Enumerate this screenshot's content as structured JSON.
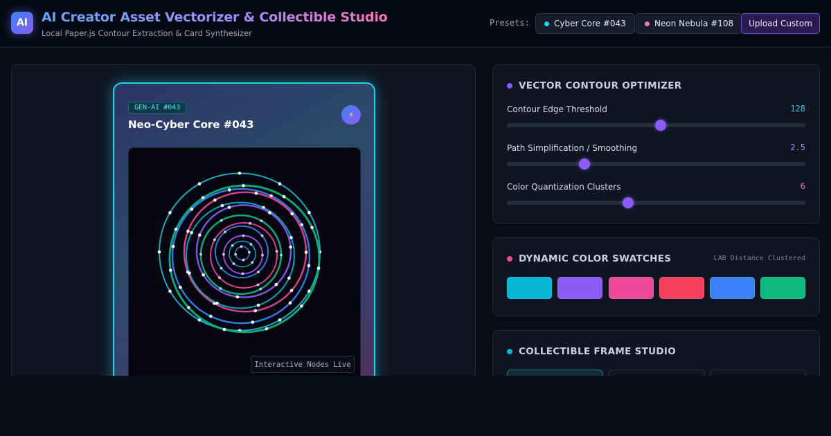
{
  "header": {
    "logo_text": "AI",
    "title": "AI Creator Asset Vectorizer & Collectible Studio",
    "subtitle": "Local Paper.js Contour Extraction & Card Synthesizer",
    "presets_label": "Presets:",
    "presets": [
      {
        "label": "Cyber Core #043",
        "color": "#22d3ee"
      },
      {
        "label": "Neon Nebula #108",
        "color": "#f472b6"
      }
    ],
    "upload_label": "Upload Custom"
  },
  "card": {
    "badge": "GEN-AI #043",
    "title": "Neo-Cyber Core #043",
    "bolt_icon": "lightning-icon",
    "live_tag": "Interactive Nodes Live"
  },
  "optimizer": {
    "title": "VECTOR CONTOUR OPTIMIZER",
    "dot_color": "#8b5cf6",
    "sliders": [
      {
        "label": "Contour Edge Threshold",
        "value": "128",
        "fraction": 0.515,
        "value_color": "#22d3ee"
      },
      {
        "label": "Path Simplification / Smoothing",
        "value": "2.5",
        "fraction": 0.26,
        "value_color": "#a78bfa"
      },
      {
        "label": "Color Quantization Clusters",
        "value": "6",
        "fraction": 0.405,
        "value_color": "#f472b6"
      }
    ]
  },
  "swatches": {
    "title": "DYNAMIC COLOR SWATCHES",
    "dot_color": "#ec4899",
    "note": "LAB Distance Clustered",
    "colors": [
      "#06b6d4",
      "#8b5cf6",
      "#ec4899",
      "#f43f5e",
      "#3b82f6",
      "#10b981"
    ]
  },
  "frames": {
    "title": "COLLECTIBLE FRAME STUDIO",
    "dot_color": "#06b6d4"
  }
}
